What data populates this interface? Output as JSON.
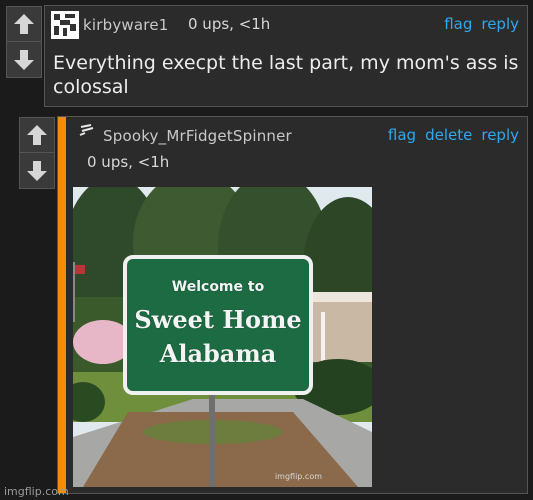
{
  "comment1": {
    "username": "kirbyware1",
    "meta": "0 ups, <1h",
    "actions": [
      "flag",
      "reply"
    ],
    "text_line1": "Everything execpt the last part, my mom's ass is",
    "text_line2": "colossal",
    "avatar_icon": "pixel-avatar-icon"
  },
  "comment2": {
    "username": "Spooky_MrFidgetSpinner",
    "meta": "0 ups, <1h",
    "actions": [
      "flag",
      "delete",
      "reply"
    ],
    "image": {
      "sign_line1": "Welcome to",
      "sign_line2": "Sweet Home",
      "sign_line3": "Alabama",
      "inner_watermark": "imgflip.com"
    },
    "reply_bar_color": "#f28c0c"
  },
  "vote": {
    "up_icon": "upvote-arrow-icon",
    "down_icon": "downvote-arrow-icon"
  },
  "footer": {
    "watermark": "imgflip.com"
  },
  "colors": {
    "background": "#1b1b1c",
    "box": "#2b2b2c",
    "link": "#2ea9ee",
    "accent": "#f28c0c"
  }
}
